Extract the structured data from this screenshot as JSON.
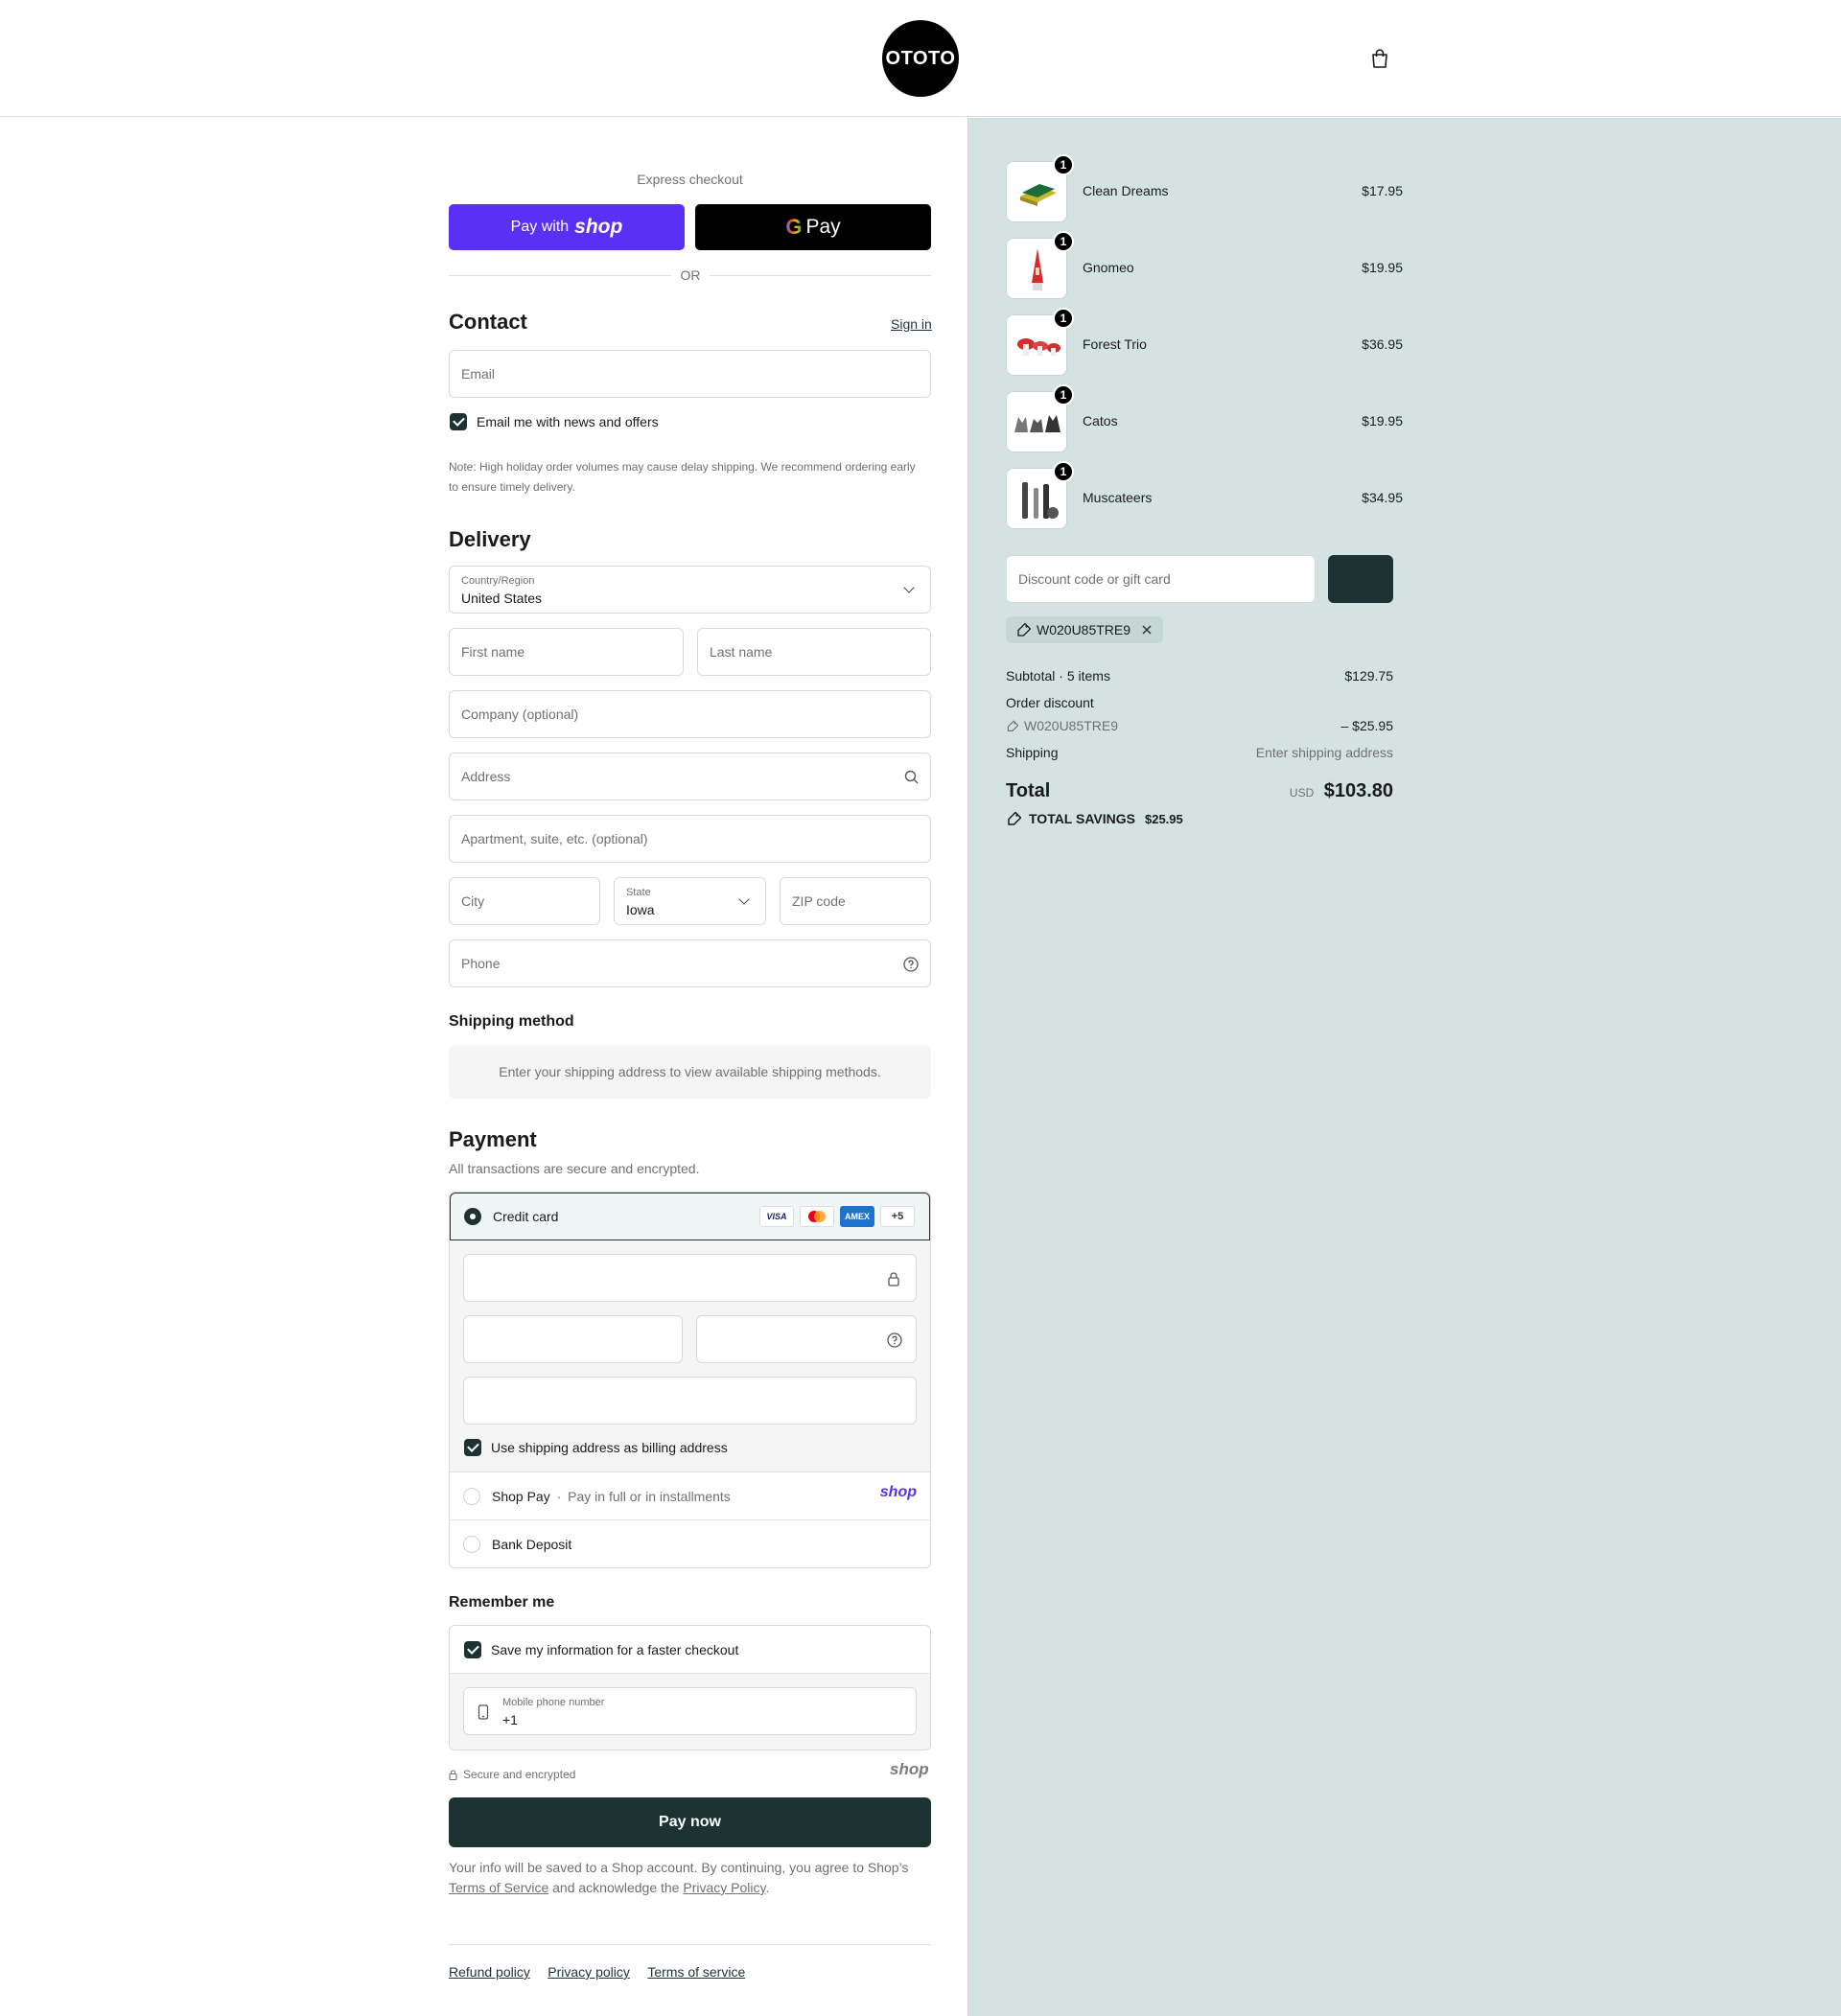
{
  "header": {
    "logo_text": "OTOTO",
    "cart_icon": "shopping-bag-icon"
  },
  "express": {
    "label": "Express checkout",
    "shop_pay_prefix": "Pay with",
    "shop_pay_brand": "shop",
    "gpay_label": "Pay",
    "divider": "OR"
  },
  "contact": {
    "title": "Contact",
    "sign_in": "Sign in",
    "email_placeholder": "Email",
    "newsletter_label": "Email me with news and offers",
    "note": "Note: High holiday order volumes may cause delay shipping. We recommend ordering early to ensure timely delivery."
  },
  "delivery": {
    "title": "Delivery",
    "country_label": "Country/Region",
    "country_value": "United States",
    "first_name": "First name",
    "last_name": "Last name",
    "company": "Company (optional)",
    "address": "Address",
    "apartment": "Apartment, suite, etc. (optional)",
    "city": "City",
    "state_label": "State",
    "state_value": "Iowa",
    "zip": "ZIP code",
    "phone": "Phone"
  },
  "shipping_method": {
    "title": "Shipping method",
    "message": "Enter your shipping address to view available shipping methods."
  },
  "payment": {
    "title": "Payment",
    "subtitle": "All transactions are secure and encrypted.",
    "credit_card": "Credit card",
    "card_brands": {
      "visa": "VISA",
      "amex": "AMEX",
      "more": "+5"
    },
    "billing_same": "Use shipping address as billing address",
    "shop_pay_label": "Shop Pay",
    "shop_pay_sep": "·",
    "shop_pay_desc": "Pay in full or in installments",
    "shop_pay_brand": "shop",
    "bank_deposit": "Bank Deposit"
  },
  "remember": {
    "title": "Remember me",
    "save_label": "Save my information for a faster checkout",
    "phone_label": "Mobile phone number",
    "phone_value": "+1",
    "secure_label": "Secure and encrypted",
    "shop_brand": "shop"
  },
  "pay_now": "Pay now",
  "legal": {
    "text1": "Your info will be saved to a Shop account. By continuing, you agree to Shop’s",
    "tos": "Terms of Service",
    "text2": "and acknowledge the",
    "privacy": "Privacy Policy",
    "end": "."
  },
  "footer": {
    "refund": "Refund policy",
    "privacy": "Privacy policy",
    "terms": "Terms of service"
  },
  "cart": {
    "items": [
      {
        "name": "Clean Dreams",
        "price": "$17.95",
        "qty": "1"
      },
      {
        "name": "Gnomeo",
        "price": "$19.95",
        "qty": "1"
      },
      {
        "name": "Forest Trio",
        "price": "$36.95",
        "qty": "1"
      },
      {
        "name": "Catos",
        "price": "$19.95",
        "qty": "1"
      },
      {
        "name": "Muscateers",
        "price": "$34.95",
        "qty": "1"
      }
    ],
    "discount_placeholder": "Discount code or gift card",
    "applied_code": "W020U85TRE9",
    "subtotal_label": "Subtotal · 5 items",
    "subtotal_value": "$129.75",
    "order_discount_label": "Order discount",
    "order_discount_code": "W020U85TRE9",
    "order_discount_value": "– $25.95",
    "shipping_label": "Shipping",
    "shipping_value": "Enter shipping address",
    "total_label": "Total",
    "total_currency": "USD",
    "total_value": "$103.80",
    "savings_label": "TOTAL SAVINGS",
    "savings_value": "$25.95"
  },
  "colors": {
    "shop_purple": "#5a31f4",
    "dark_teal": "#1d3333",
    "summary_bg": "#d4e3e2"
  }
}
